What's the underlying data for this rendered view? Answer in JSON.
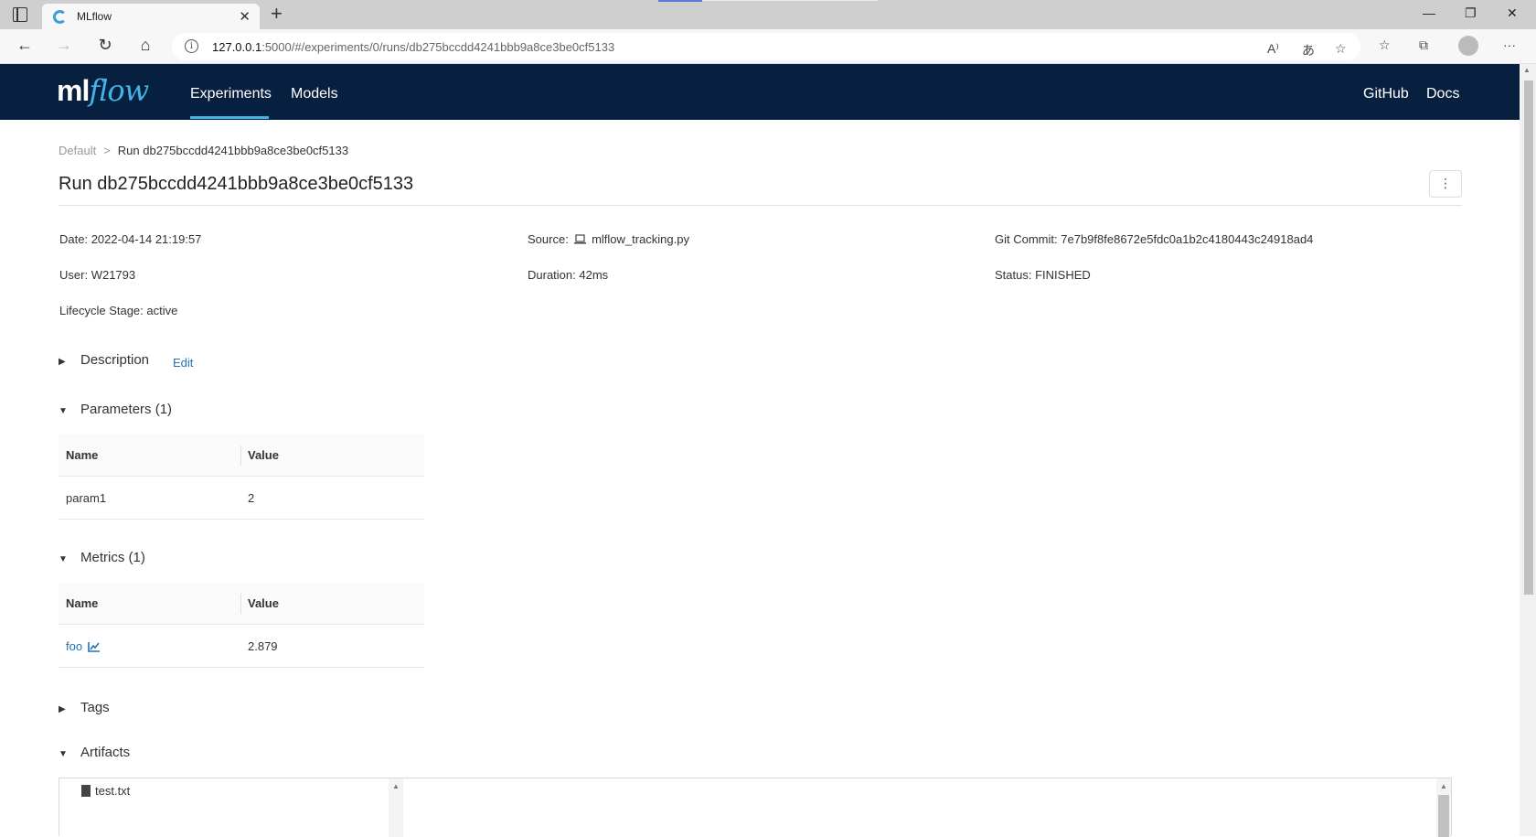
{
  "browser": {
    "tab_title": "MLflow",
    "url_host": "127.0.0.1",
    "url_rest": ":5000/#/experiments/0/runs/db275bccdd4241bbb9a8ce3be0cf5133",
    "close_tab_glyph": "✕",
    "new_tab_glyph": "+",
    "minimize_glyph": "—",
    "restore_glyph": "❐",
    "close_window_glyph": "✕",
    "back_glyph": "←",
    "forward_glyph": "→",
    "refresh_glyph": "↻",
    "home_glyph": "⌂",
    "read_aloud_glyph": "A⁾",
    "translate_glyph": "あ",
    "favorite_glyph": "☆",
    "favorites_glyph": "☆",
    "collections_glyph": "⧉",
    "more_glyph": "···"
  },
  "header": {
    "logo_ml": "ml",
    "logo_flow": "flow",
    "nav": [
      "Experiments",
      "Models"
    ],
    "right_links": [
      "GitHub",
      "Docs"
    ]
  },
  "breadcrumb": {
    "parent": "Default",
    "separator": ">",
    "current": "Run db275bccdd4241bbb9a8ce3be0cf5133"
  },
  "page_title": "Run db275bccdd4241bbb9a8ce3be0cf5133",
  "kebab_glyph": "⋮",
  "meta": {
    "date_label": "Date:",
    "date_value": "2022-04-14 21:19:57",
    "source_label": "Source:",
    "source_value": "mlflow_tracking.py",
    "git_label": "Git Commit:",
    "git_value": "7e7b9f8fe8672e5fdc0a1b2c4180443c24918ad4",
    "user_label": "User:",
    "user_value": "W21793",
    "duration_label": "Duration:",
    "duration_value": "42ms",
    "status_label": "Status:",
    "status_value": "FINISHED",
    "lifecycle_label": "Lifecycle Stage:",
    "lifecycle_value": "active"
  },
  "sections": {
    "description": "Description",
    "edit": "Edit",
    "parameters": "Parameters (1)",
    "metrics": "Metrics (1)",
    "tags": "Tags",
    "artifacts": "Artifacts"
  },
  "parameters_table": {
    "headers": [
      "Name",
      "Value"
    ],
    "rows": [
      [
        "param1",
        "2"
      ]
    ]
  },
  "metrics_table": {
    "headers": [
      "Name",
      "Value"
    ],
    "rows": [
      [
        "foo",
        "2.879"
      ]
    ]
  },
  "artifacts": {
    "files": [
      "test.txt"
    ]
  }
}
